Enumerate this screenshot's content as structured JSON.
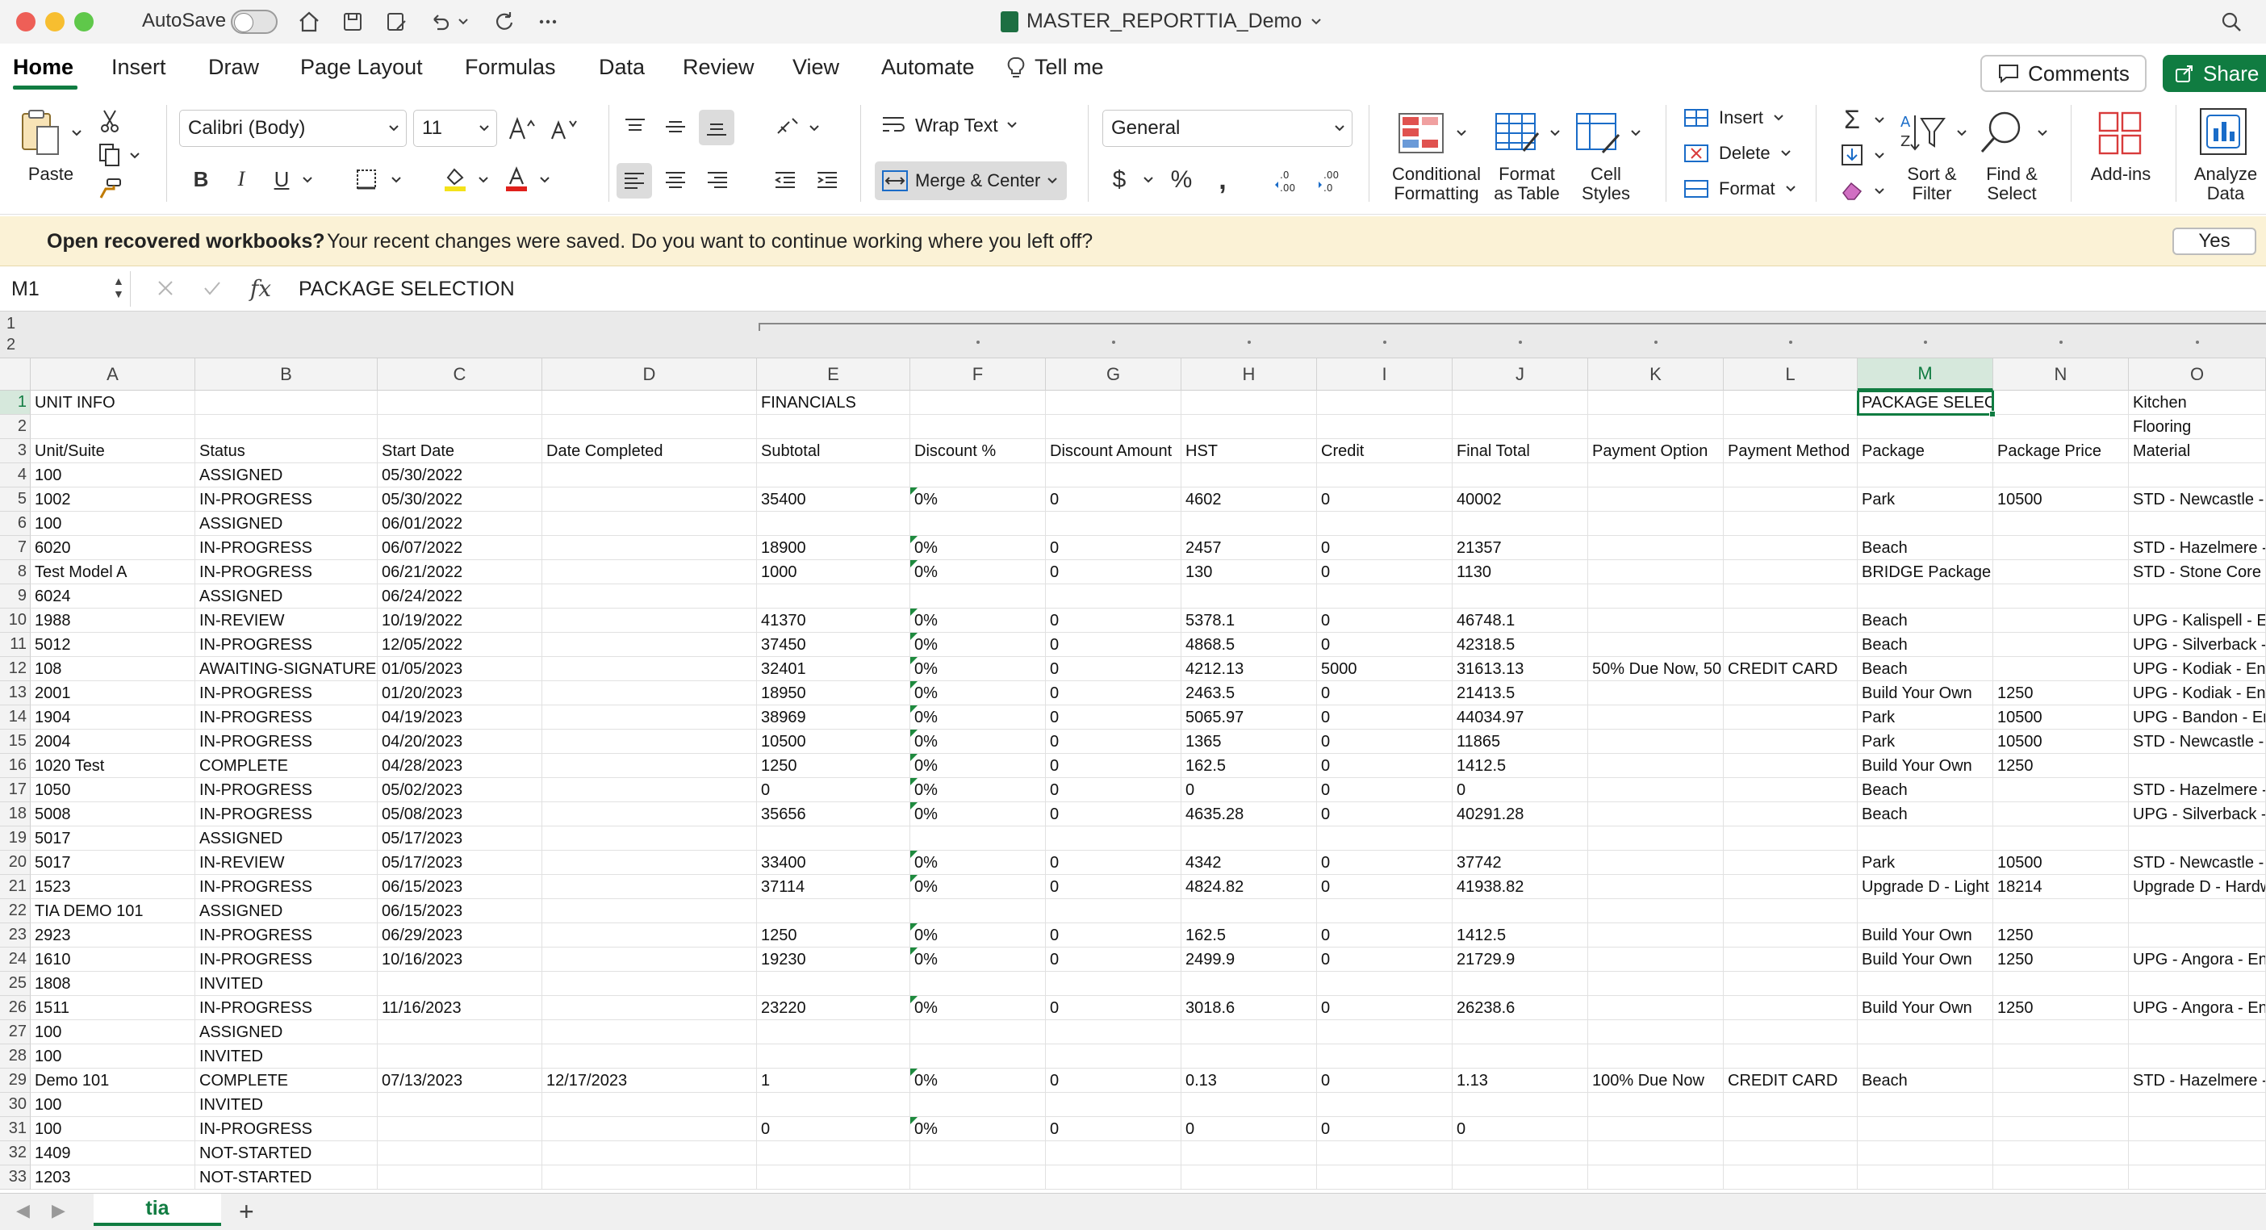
{
  "titlebar": {
    "autosave_label": "AutoSave",
    "doc_title": "MASTER_REPORTTIA_Demo"
  },
  "tabs": [
    "Home",
    "Insert",
    "Draw",
    "Page Layout",
    "Formulas",
    "Data",
    "Review",
    "View",
    "Automate",
    "Tell me"
  ],
  "buttons": {
    "comments": "Comments",
    "share": "Share"
  },
  "ribbon": {
    "paste": "Paste",
    "font_name": "Calibri (Body)",
    "font_size": "11",
    "wrap_text": "Wrap Text",
    "merge_center": "Merge & Center",
    "number_format": "General",
    "conditional_formatting": [
      "Conditional",
      "Formatting"
    ],
    "format_as_table": [
      "Format",
      "as Table"
    ],
    "cell_styles": [
      "Cell",
      "Styles"
    ],
    "insert": "Insert",
    "delete": "Delete",
    "format": "Format",
    "sort_filter": [
      "Sort &",
      "Filter"
    ],
    "find_select": [
      "Find &",
      "Select"
    ],
    "add_ins": "Add-ins",
    "analyze_data": [
      "Analyze",
      "Data"
    ]
  },
  "infobar": {
    "title": "Open recovered workbooks?",
    "message": "Your recent changes were saved. Do you want to continue working where you left off?",
    "yes": "Yes"
  },
  "formulabar": {
    "namebox": "M1",
    "formula": "PACKAGE SELECTION"
  },
  "outline_levels": [
    "1",
    "2"
  ],
  "columns": [
    "A",
    "B",
    "C",
    "D",
    "E",
    "F",
    "G",
    "H",
    "I",
    "J",
    "K",
    "L",
    "M",
    "N",
    "O"
  ],
  "rows": [
    [
      "1",
      "UNIT INFO",
      "",
      "",
      "",
      "FINANCIALS",
      "",
      "",
      "",
      "",
      "",
      "",
      "",
      "PACKAGE SELECTION",
      "",
      "Kitchen"
    ],
    [
      "2",
      "",
      "",
      "",
      "",
      "",
      "",
      "",
      "",
      "",
      "",
      "",
      "",
      "",
      "",
      "Flooring"
    ],
    [
      "3",
      "Unit/Suite",
      "Status",
      "Start Date",
      "Date Completed",
      "Subtotal",
      "Discount %",
      "Discount Amount",
      "HST",
      "Credit",
      "Final Total",
      "Payment Option",
      "Payment Method",
      "Package",
      "Package Price",
      "Material"
    ],
    [
      "4",
      "100",
      "ASSIGNED",
      "05/30/2022",
      "",
      "",
      "",
      "",
      "",
      "",
      "",
      "",
      "",
      "",
      "",
      ""
    ],
    [
      "5",
      "1002",
      "IN-PROGRESS",
      "05/30/2022",
      "",
      "35400",
      "0%",
      "0",
      "4602",
      "0",
      "40002",
      "",
      "",
      "Park",
      "10500",
      "STD - Newcastle - E"
    ],
    [
      "6",
      "100",
      "ASSIGNED",
      "06/01/2022",
      "",
      "",
      "",
      "",
      "",
      "",
      "",
      "",
      "",
      "",
      "",
      ""
    ],
    [
      "7",
      "6020",
      "IN-PROGRESS",
      "06/07/2022",
      "",
      "18900",
      "0%",
      "0",
      "2457",
      "0",
      "21357",
      "",
      "",
      "Beach",
      "",
      "STD - Hazelmere - E"
    ],
    [
      "8",
      "Test Model A",
      "IN-PROGRESS",
      "06/21/2022",
      "",
      "1000",
      "0%",
      "0",
      "130",
      "0",
      "1130",
      "",
      "",
      "BRIDGE Package",
      "",
      "STD - Stone Core Li"
    ],
    [
      "9",
      "6024",
      "ASSIGNED",
      "06/24/2022",
      "",
      "",
      "",
      "",
      "",
      "",
      "",
      "",
      "",
      "",
      "",
      ""
    ],
    [
      "10",
      "1988",
      "IN-REVIEW",
      "10/19/2022",
      "",
      "41370",
      "0%",
      "0",
      "5378.1",
      "0",
      "46748.1",
      "",
      "",
      "Beach",
      "",
      "UPG - Kalispell - En"
    ],
    [
      "11",
      "5012",
      "IN-PROGRESS",
      "12/05/2022",
      "",
      "37450",
      "0%",
      "0",
      "4868.5",
      "0",
      "42318.5",
      "",
      "",
      "Beach",
      "",
      "UPG - Silverback - I"
    ],
    [
      "12",
      "108",
      "AWAITING-SIGNATURE",
      "01/05/2023",
      "",
      "32401",
      "0%",
      "0",
      "4212.13",
      "5000",
      "31613.13",
      "50% Due Now, 50",
      "CREDIT CARD",
      "Beach",
      "",
      "UPG - Kodiak - Eng"
    ],
    [
      "13",
      "2001",
      "IN-PROGRESS",
      "01/20/2023",
      "",
      "18950",
      "0%",
      "0",
      "2463.5",
      "0",
      "21413.5",
      "",
      "",
      "Build Your Own",
      "1250",
      "UPG - Kodiak - Eng"
    ],
    [
      "14",
      "1904",
      "IN-PROGRESS",
      "04/19/2023",
      "",
      "38969",
      "0%",
      "0",
      "5065.97",
      "0",
      "44034.97",
      "",
      "",
      "Park",
      "10500",
      "UPG - Bandon - Eng"
    ],
    [
      "15",
      "2004",
      "IN-PROGRESS",
      "04/20/2023",
      "",
      "10500",
      "0%",
      "0",
      "1365",
      "0",
      "11865",
      "",
      "",
      "Park",
      "10500",
      "STD - Newcastle - E"
    ],
    [
      "16",
      "1020 Test",
      "COMPLETE",
      "04/28/2023",
      "",
      "1250",
      "0%",
      "0",
      "162.5",
      "0",
      "1412.5",
      "",
      "",
      "Build Your Own",
      "1250",
      ""
    ],
    [
      "17",
      "1050",
      "IN-PROGRESS",
      "05/02/2023",
      "",
      "0",
      "0%",
      "0",
      "0",
      "0",
      "0",
      "",
      "",
      "Beach",
      "",
      "STD - Hazelmere - E"
    ],
    [
      "18",
      "5008",
      "IN-PROGRESS",
      "05/08/2023",
      "",
      "35656",
      "0%",
      "0",
      "4635.28",
      "0",
      "40291.28",
      "",
      "",
      "Beach",
      "",
      "UPG - Silverback - I"
    ],
    [
      "19",
      "5017",
      "ASSIGNED",
      "05/17/2023",
      "",
      "",
      "",
      "",
      "",
      "",
      "",
      "",
      "",
      "",
      "",
      ""
    ],
    [
      "20",
      "5017",
      "IN-REVIEW",
      "05/17/2023",
      "",
      "33400",
      "0%",
      "0",
      "4342",
      "0",
      "37742",
      "",
      "",
      "Park",
      "10500",
      "STD - Newcastle - E"
    ],
    [
      "21",
      "1523",
      "IN-PROGRESS",
      "06/15/2023",
      "",
      "37114",
      "0%",
      "0",
      "4824.82",
      "0",
      "41938.82",
      "",
      "",
      "Upgrade D - Light",
      "18214",
      "Upgrade D - Hardw"
    ],
    [
      "22",
      "TIA DEMO 101",
      "ASSIGNED",
      "06/15/2023",
      "",
      "",
      "",
      "",
      "",
      "",
      "",
      "",
      "",
      "",
      "",
      ""
    ],
    [
      "23",
      "2923",
      "IN-PROGRESS",
      "06/29/2023",
      "",
      "1250",
      "0%",
      "0",
      "162.5",
      "0",
      "1412.5",
      "",
      "",
      "Build Your Own",
      "1250",
      ""
    ],
    [
      "24",
      "1610",
      "IN-PROGRESS",
      "10/16/2023",
      "",
      "19230",
      "0%",
      "0",
      "2499.9",
      "0",
      "21729.9",
      "",
      "",
      "Build Your Own",
      "1250",
      "UPG - Angora - Eng"
    ],
    [
      "25",
      "1808",
      "INVITED",
      "",
      "",
      "",
      "",
      "",
      "",
      "",
      "",
      "",
      "",
      "",
      "",
      ""
    ],
    [
      "26",
      "1511",
      "IN-PROGRESS",
      "11/16/2023",
      "",
      "23220",
      "0%",
      "0",
      "3018.6",
      "0",
      "26238.6",
      "",
      "",
      "Build Your Own",
      "1250",
      "UPG - Angora - Eng"
    ],
    [
      "27",
      "100",
      "ASSIGNED",
      "",
      "",
      "",
      "",
      "",
      "",
      "",
      "",
      "",
      "",
      "",
      "",
      ""
    ],
    [
      "28",
      "100",
      "INVITED",
      "",
      "",
      "",
      "",
      "",
      "",
      "",
      "",
      "",
      "",
      "",
      "",
      ""
    ],
    [
      "29",
      "Demo 101",
      "COMPLETE",
      "07/13/2023",
      "12/17/2023",
      "1",
      "0%",
      "0",
      "0.13",
      "0",
      "1.13",
      "100% Due Now",
      "CREDIT CARD",
      "Beach",
      "",
      "STD - Hazelmere - E"
    ],
    [
      "30",
      "100",
      "INVITED",
      "",
      "",
      "",
      "",
      "",
      "",
      "",
      "",
      "",
      "",
      "",
      "",
      ""
    ],
    [
      "31",
      "100",
      "IN-PROGRESS",
      "",
      "",
      "0",
      "0%",
      "0",
      "0",
      "0",
      "0",
      "",
      "",
      "",
      "",
      ""
    ],
    [
      "32",
      "1409",
      "NOT-STARTED",
      "",
      "",
      "",
      "",
      "",
      "",
      "",
      "",
      "",
      "",
      "",
      "",
      ""
    ],
    [
      "33",
      "1203",
      "NOT-STARTED",
      "",
      "",
      "",
      "",
      "",
      "",
      "",
      "",
      "",
      "",
      "",
      "",
      ""
    ]
  ],
  "sheet_tab": "tia",
  "colors": {
    "accent": "#107c41",
    "infobar": "#fbf2d6"
  }
}
